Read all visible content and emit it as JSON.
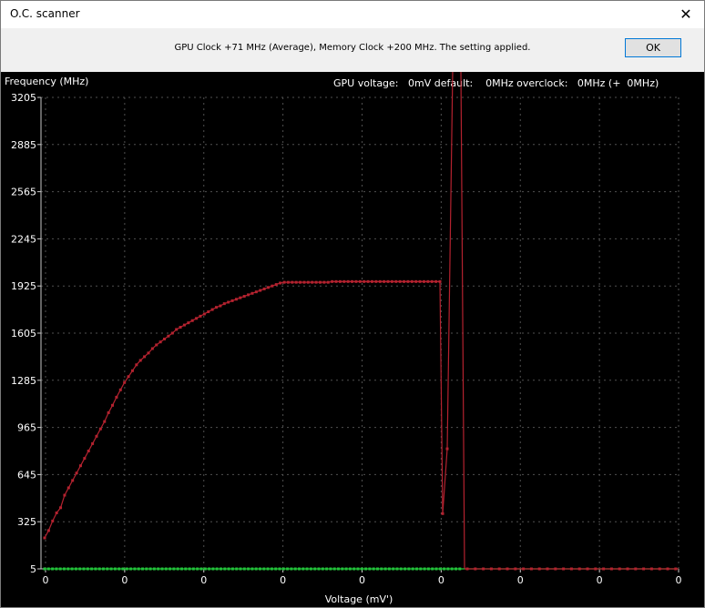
{
  "window": {
    "title": "O.C. scanner",
    "close_glyph": "✕"
  },
  "message": {
    "text": "GPU Clock +71 MHz (Average), Memory Clock +200 MHz. The setting applied.",
    "ok_label": "OK"
  },
  "chart_data": {
    "type": "line",
    "ylabel": "Frequency (MHz)",
    "xlabel": "Voltage (mV')",
    "info": "GPU voltage:   0mV default:    0MHz overclock:   0MHz (+  0MHz)",
    "y_ticks": [
      "3205",
      "2885",
      "2565",
      "2245",
      "1925",
      "1605",
      "1285",
      "965",
      "645",
      "325",
      "5"
    ],
    "x_ticks": [
      "0",
      "0",
      "0",
      "0",
      "0",
      "0",
      "0",
      "0",
      "0"
    ],
    "ylim": [
      5,
      3205
    ],
    "grid": true,
    "colors": {
      "background": "#000000",
      "grid": "#505050",
      "axis": "#c8c8c8",
      "series_red": "#b4222f",
      "series_green": "#22c43a"
    },
    "series": [
      {
        "color": "#b4222f",
        "values": [
          215,
          265,
          330,
          385,
          420,
          505,
          555,
          605,
          655,
          705,
          755,
          805,
          855,
          905,
          955,
          1005,
          1065,
          1115,
          1170,
          1220,
          1270,
          1310,
          1350,
          1390,
          1420,
          1445,
          1470,
          1500,
          1525,
          1545,
          1565,
          1585,
          1605,
          1630,
          1645,
          1660,
          1675,
          1690,
          1705,
          1720,
          1735,
          1750,
          1765,
          1780,
          1790,
          1805,
          1815,
          1825,
          1835,
          1845,
          1855,
          1865,
          1875,
          1885,
          1895,
          1905,
          1915,
          1925,
          1935,
          1945,
          1950,
          1950,
          1950,
          1950,
          1950,
          1950,
          1950,
          1950,
          1950,
          1950,
          1950,
          1950,
          1955,
          1955,
          1955,
          1955,
          1955,
          1955,
          1955,
          1955,
          1955,
          1955,
          1955,
          1955,
          1955,
          1955,
          1955,
          1955,
          1955,
          1955,
          1955,
          1955,
          1955,
          1955,
          1955,
          1955,
          1955,
          1955,
          1955,
          1955
        ]
      },
      {
        "color": "#22c43a",
        "values": "flat at 5 across all points"
      }
    ]
  }
}
